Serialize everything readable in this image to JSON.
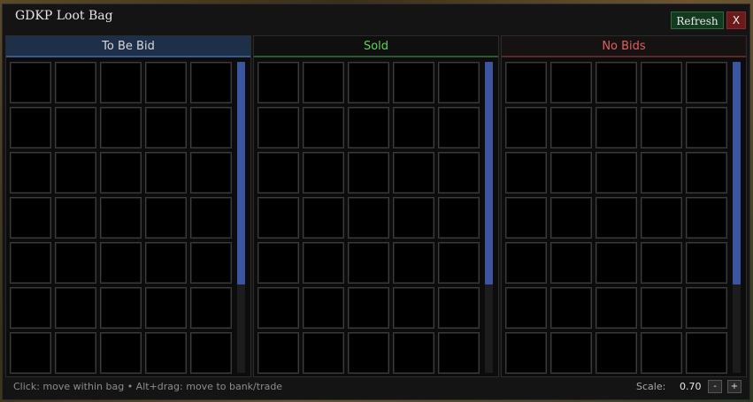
{
  "window": {
    "title": "GDKP Loot Bag",
    "refresh_label": "Refresh",
    "close_label": "X"
  },
  "panels": [
    {
      "label": "To Be Bid",
      "color": "#d8d8d8"
    },
    {
      "label": "Sold",
      "color": "#5fd35f"
    },
    {
      "label": "No Bids",
      "color": "#e06060"
    }
  ],
  "footer": {
    "hint": "Click: move within bag  •  Alt+drag: move to bank/trade",
    "scale_label": "Scale:",
    "scale_value": "0.70",
    "decrease_label": "-",
    "increase_label": "+"
  }
}
